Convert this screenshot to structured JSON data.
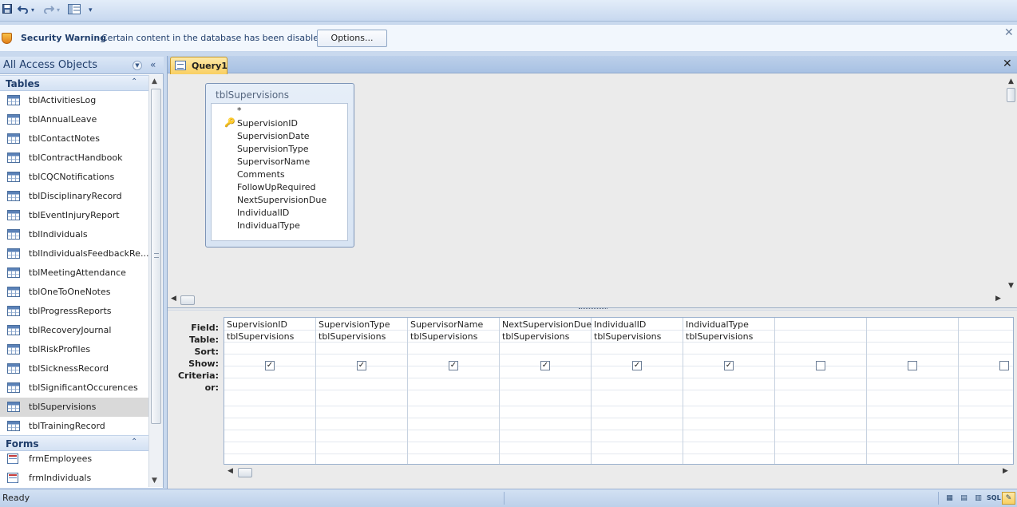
{
  "qat": {
    "save_icon": "save-icon",
    "undo_icon": "undo-icon",
    "redo_icon": "redo-icon",
    "view_icon": "view-icon",
    "customize_icon": "customize-qat-icon"
  },
  "message_bar": {
    "title": "Security Warning",
    "text": "Certain content in the database has been disabled",
    "options_label": "Options..."
  },
  "nav": {
    "header": "All Access Objects",
    "groups": [
      {
        "label": "Tables"
      },
      {
        "label": "Forms"
      }
    ],
    "tables": [
      "tblActivitiesLog",
      "tblAnnualLeave",
      "tblContactNotes",
      "tblContractHandbook",
      "tblCQCNotifications",
      "tblDisciplinaryRecord",
      "tblEventInjuryReport",
      "tblIndividuals",
      "tblIndividualsFeedbackRe...",
      "tblMeetingAttendance",
      "tblOneToOneNotes",
      "tblProgressReports",
      "tblRecoveryJournal",
      "tblRiskProfiles",
      "tblSicknessRecord",
      "tblSignificantOccurences",
      "tblSupervisions",
      "tblTrainingRecord"
    ],
    "selected_table": "tblSupervisions",
    "forms": [
      "frmEmployees",
      "frmIndividuals"
    ]
  },
  "document": {
    "tab_label": "Query1"
  },
  "field_list": {
    "title": "tblSupervisions",
    "fields": [
      "*",
      "SupervisionID",
      "SupervisionDate",
      "SupervisionType",
      "SupervisorName",
      "Comments",
      "FollowUpRequired",
      "NextSupervisionDue",
      "IndividualID",
      "IndividualType"
    ],
    "primary_key": "SupervisionID"
  },
  "qbe": {
    "row_labels": [
      "Field:",
      "Table:",
      "Sort:",
      "Show:",
      "Criteria:",
      "or:"
    ],
    "columns": [
      {
        "field": "SupervisionID",
        "table": "tblSupervisions",
        "show": true
      },
      {
        "field": "SupervisionType",
        "table": "tblSupervisions",
        "show": true
      },
      {
        "field": "SupervisorName",
        "table": "tblSupervisions",
        "show": true
      },
      {
        "field": "NextSupervisionDue",
        "table": "tblSupervisions",
        "show": true
      },
      {
        "field": "IndividualID",
        "table": "tblSupervisions",
        "show": true
      },
      {
        "field": "IndividualType",
        "table": "tblSupervisions",
        "show": true
      },
      {
        "field": "",
        "table": "",
        "show": false
      },
      {
        "field": "",
        "table": "",
        "show": false
      },
      {
        "field": "",
        "table": "",
        "show": false
      }
    ]
  },
  "status": {
    "text": "Ready",
    "views": [
      "datasheet-view-icon",
      "pivottable-view-icon",
      "pivotchart-view-icon",
      "SQL",
      "design-view-icon"
    ],
    "sql_label": "SQL"
  }
}
